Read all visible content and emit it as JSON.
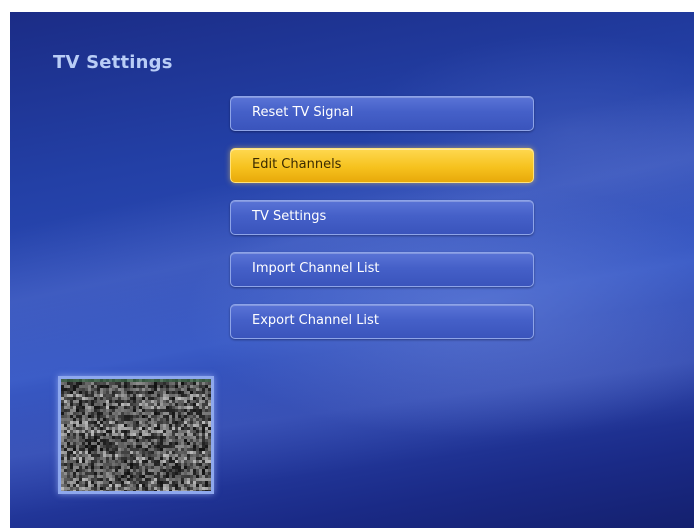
{
  "header": {
    "title": "TV Settings"
  },
  "menu": {
    "items": [
      {
        "label": "Reset TV Signal"
      },
      {
        "label": "Edit Channels"
      },
      {
        "label": "TV Settings"
      },
      {
        "label": "Import Channel List"
      },
      {
        "label": "Export Channel List"
      }
    ],
    "selected": "Edit Channels"
  },
  "colors": {
    "background": "#2340a6",
    "title": "#b9cdf6",
    "button": "#4560c8",
    "button_selected": "#f6c21e"
  }
}
